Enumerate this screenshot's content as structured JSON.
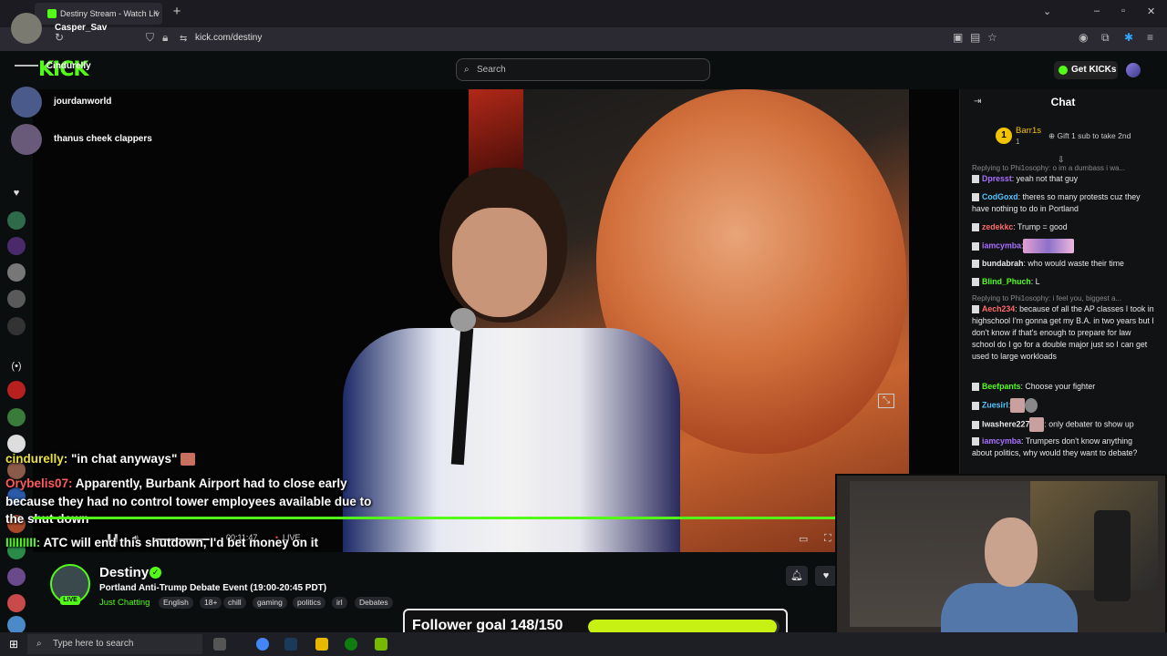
{
  "browser": {
    "tab_title": "Destiny Stream - Watch Liv",
    "profile_name": "Casper_Sav",
    "url": "kick.com/destiny",
    "new_tab_symbol": "+",
    "tab_close_symbol": "×"
  },
  "topnav": {
    "logo": "KICK",
    "search_placeholder": "Search",
    "get_kicks_label": "Get KICKs"
  },
  "overlay_users": [
    {
      "name": "Cindurelly"
    },
    {
      "name": "jourdanworld"
    },
    {
      "name": "thanus cheek clappers"
    }
  ],
  "video_overlay_chat": [
    {
      "user": "cindurelly:",
      "text": " \"in chat anyways\"",
      "color": "#eae23b"
    },
    {
      "user": "Orybelis07:",
      "text": " Apparently, Burbank Airport had to close early",
      "color": "#ff5b5b"
    },
    {
      "user": "",
      "text": "because they had no control tower employees available due to",
      "color": "#ffffff"
    },
    {
      "user": "",
      "text": "the shut down",
      "color": "#ffffff"
    },
    {
      "user": "IIIIIIIII:",
      "text": " ATC will end this shutdown, I'd bet money on it",
      "color": "#53fc18"
    }
  ],
  "player": {
    "time": "00:11:47",
    "live_label": "LIVE",
    "progress": 1.0
  },
  "stream": {
    "streamer": "Destiny",
    "live_badge": "LIVE",
    "title": "Portland Anti-Trump Debate Event (19:00-20:45 PDT)",
    "category": "Just Chatting",
    "tags": [
      "English",
      "18+",
      "chill",
      "gaming",
      "politics",
      "irl",
      "Debates"
    ]
  },
  "follower_goal": {
    "label": "Follower goal 148/150",
    "current": 148,
    "target": 150,
    "bar_color": "#c7f013"
  },
  "chat": {
    "header": "Chat",
    "leader_rank": "1",
    "leader_name": "Barr1s",
    "leader_count": "1",
    "gift_text": "Gift 1 sub to take 2nd",
    "messages": [
      {
        "type": "reply",
        "text": "Replying to Phi1osophy: o im a dumbass i wa..."
      },
      {
        "user": "Dpresst",
        "text": ": yeah not that guy",
        "color": "#a970ff"
      },
      {
        "user": "CodGoxd",
        "text": ": theres so many protests cuz they have nothing to do in Portland",
        "color": "#53c4fc"
      },
      {
        "user": "zedekkc",
        "text": ": Trump = good",
        "color": "#ff6a6a"
      },
      {
        "user": "iamcymba",
        "text": ":",
        "color": "#a970ff",
        "emote": "wide"
      },
      {
        "user": "bundabrah",
        "text": ": who would waste their time",
        "color": "#e8e8e8"
      },
      {
        "user": "Blind_Phuch",
        "text": ": L",
        "color": "#53fc18"
      },
      {
        "type": "reply",
        "text": "Replying to Phi1osophy: i feel you, biggest a..."
      },
      {
        "user": "Aech234",
        "text": ": because of all the AP classes I took in highschool I'm gonna get my B.A. in two years but I don't know if that's enough to prepare for law school do I go for a double major just so I can get used to large workloads",
        "color": "#ff6a6a"
      },
      {
        "user": "Beefpants",
        "text": ": Choose your fighter",
        "color": "#53fc18"
      },
      {
        "user": "Zuesirl",
        "text": ":",
        "color": "#53c4fc",
        "emote": "small"
      },
      {
        "user": "Iwashere227",
        "text": ": only debater to show up",
        "color": "#e8e8e8",
        "emote_inline": true
      },
      {
        "user": "iamcymba",
        "text": ": Trumpers don't know anything about politics, why would they want to debate?",
        "color": "#a970ff"
      }
    ]
  },
  "taskbar": {
    "search_placeholder": "Type here to search"
  },
  "icons": {
    "search": "search-icon",
    "verified": "verified-check-icon",
    "bell": "bell-icon",
    "heart": "heart-icon"
  }
}
